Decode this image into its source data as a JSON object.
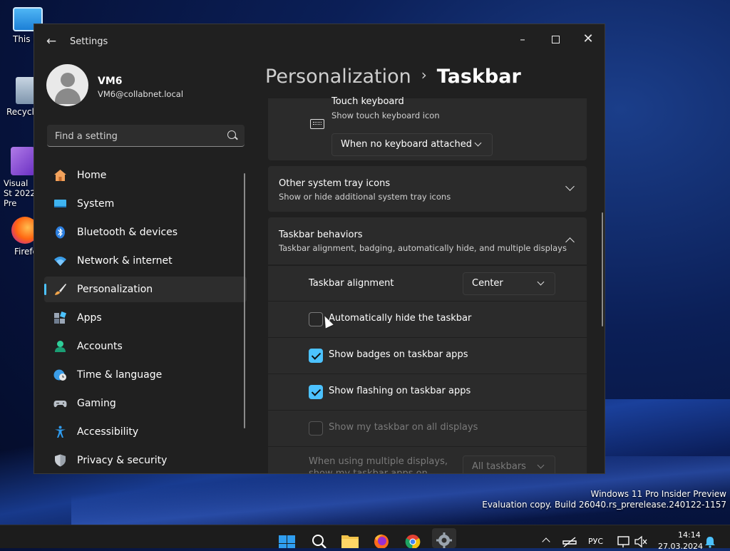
{
  "desktop": {
    "icons": [
      {
        "label": "This P",
        "icon": "monitor-icon"
      },
      {
        "label": "Recycle",
        "icon": "recycle-bin-icon"
      },
      {
        "label": "Visual St 2022 Pre",
        "icon": "visual-studio-icon"
      },
      {
        "label": "Firefo",
        "icon": "firefox-icon"
      }
    ],
    "watermark": {
      "line1": "Windows 11 Pro Insider Preview",
      "line2": "Evaluation copy. Build 26040.rs_prerelease.240122-1157"
    }
  },
  "window": {
    "title": "Settings",
    "back_icon": "back-arrow-icon",
    "controls": [
      "minimize-icon",
      "maximize-icon",
      "close-icon"
    ]
  },
  "profile": {
    "name": "VM6",
    "email": "VM6@collabnet.local"
  },
  "search": {
    "placeholder": "Find a setting"
  },
  "nav": {
    "items": [
      {
        "label": "Home",
        "icon": "home-icon"
      },
      {
        "label": "System",
        "icon": "system-icon"
      },
      {
        "label": "Bluetooth & devices",
        "icon": "bluetooth-icon"
      },
      {
        "label": "Network & internet",
        "icon": "wifi-icon"
      },
      {
        "label": "Personalization",
        "icon": "brush-icon",
        "selected": true
      },
      {
        "label": "Apps",
        "icon": "apps-icon"
      },
      {
        "label": "Accounts",
        "icon": "accounts-icon"
      },
      {
        "label": "Time & language",
        "icon": "globe-clock-icon"
      },
      {
        "label": "Gaming",
        "icon": "gamepad-icon"
      },
      {
        "label": "Accessibility",
        "icon": "accessibility-icon"
      },
      {
        "label": "Privacy & security",
        "icon": "shield-icon"
      }
    ]
  },
  "breadcrumb": {
    "parent": "Personalization",
    "separator": "›",
    "current": "Taskbar"
  },
  "touch_keyboard": {
    "title": "Touch keyboard",
    "subtitle": "Show touch keyboard icon",
    "dropdown_value": "When no keyboard attached"
  },
  "other_tray": {
    "title": "Other system tray icons",
    "subtitle": "Show or hide additional system tray icons"
  },
  "behaviors": {
    "title": "Taskbar behaviors",
    "subtitle": "Taskbar alignment, badging, automatically hide, and multiple displays",
    "alignment_label": "Taskbar alignment",
    "alignment_value": "Center",
    "options": [
      {
        "label": "Automatically hide the taskbar",
        "checked": false,
        "disabled": false
      },
      {
        "label": "Show badges on taskbar apps",
        "checked": true,
        "disabled": false
      },
      {
        "label": "Show flashing on taskbar apps",
        "checked": true,
        "disabled": false
      },
      {
        "label": "Show my taskbar on all displays",
        "checked": false,
        "disabled": true
      }
    ],
    "multi_display_label": "When using multiple displays, show my taskbar apps on",
    "multi_display_value": "All taskbars"
  },
  "taskbar": {
    "apps": [
      "start-icon",
      "search-icon",
      "file-explorer-icon",
      "firefox-icon",
      "chrome-icon",
      "settings-icon"
    ],
    "tray": {
      "language": "РУС",
      "time": "14:14",
      "date": "27.03.2024"
    }
  },
  "colors": {
    "accent": "#4cc2ff",
    "window_bg": "#202020",
    "card_bg": "#2b2b2b"
  }
}
